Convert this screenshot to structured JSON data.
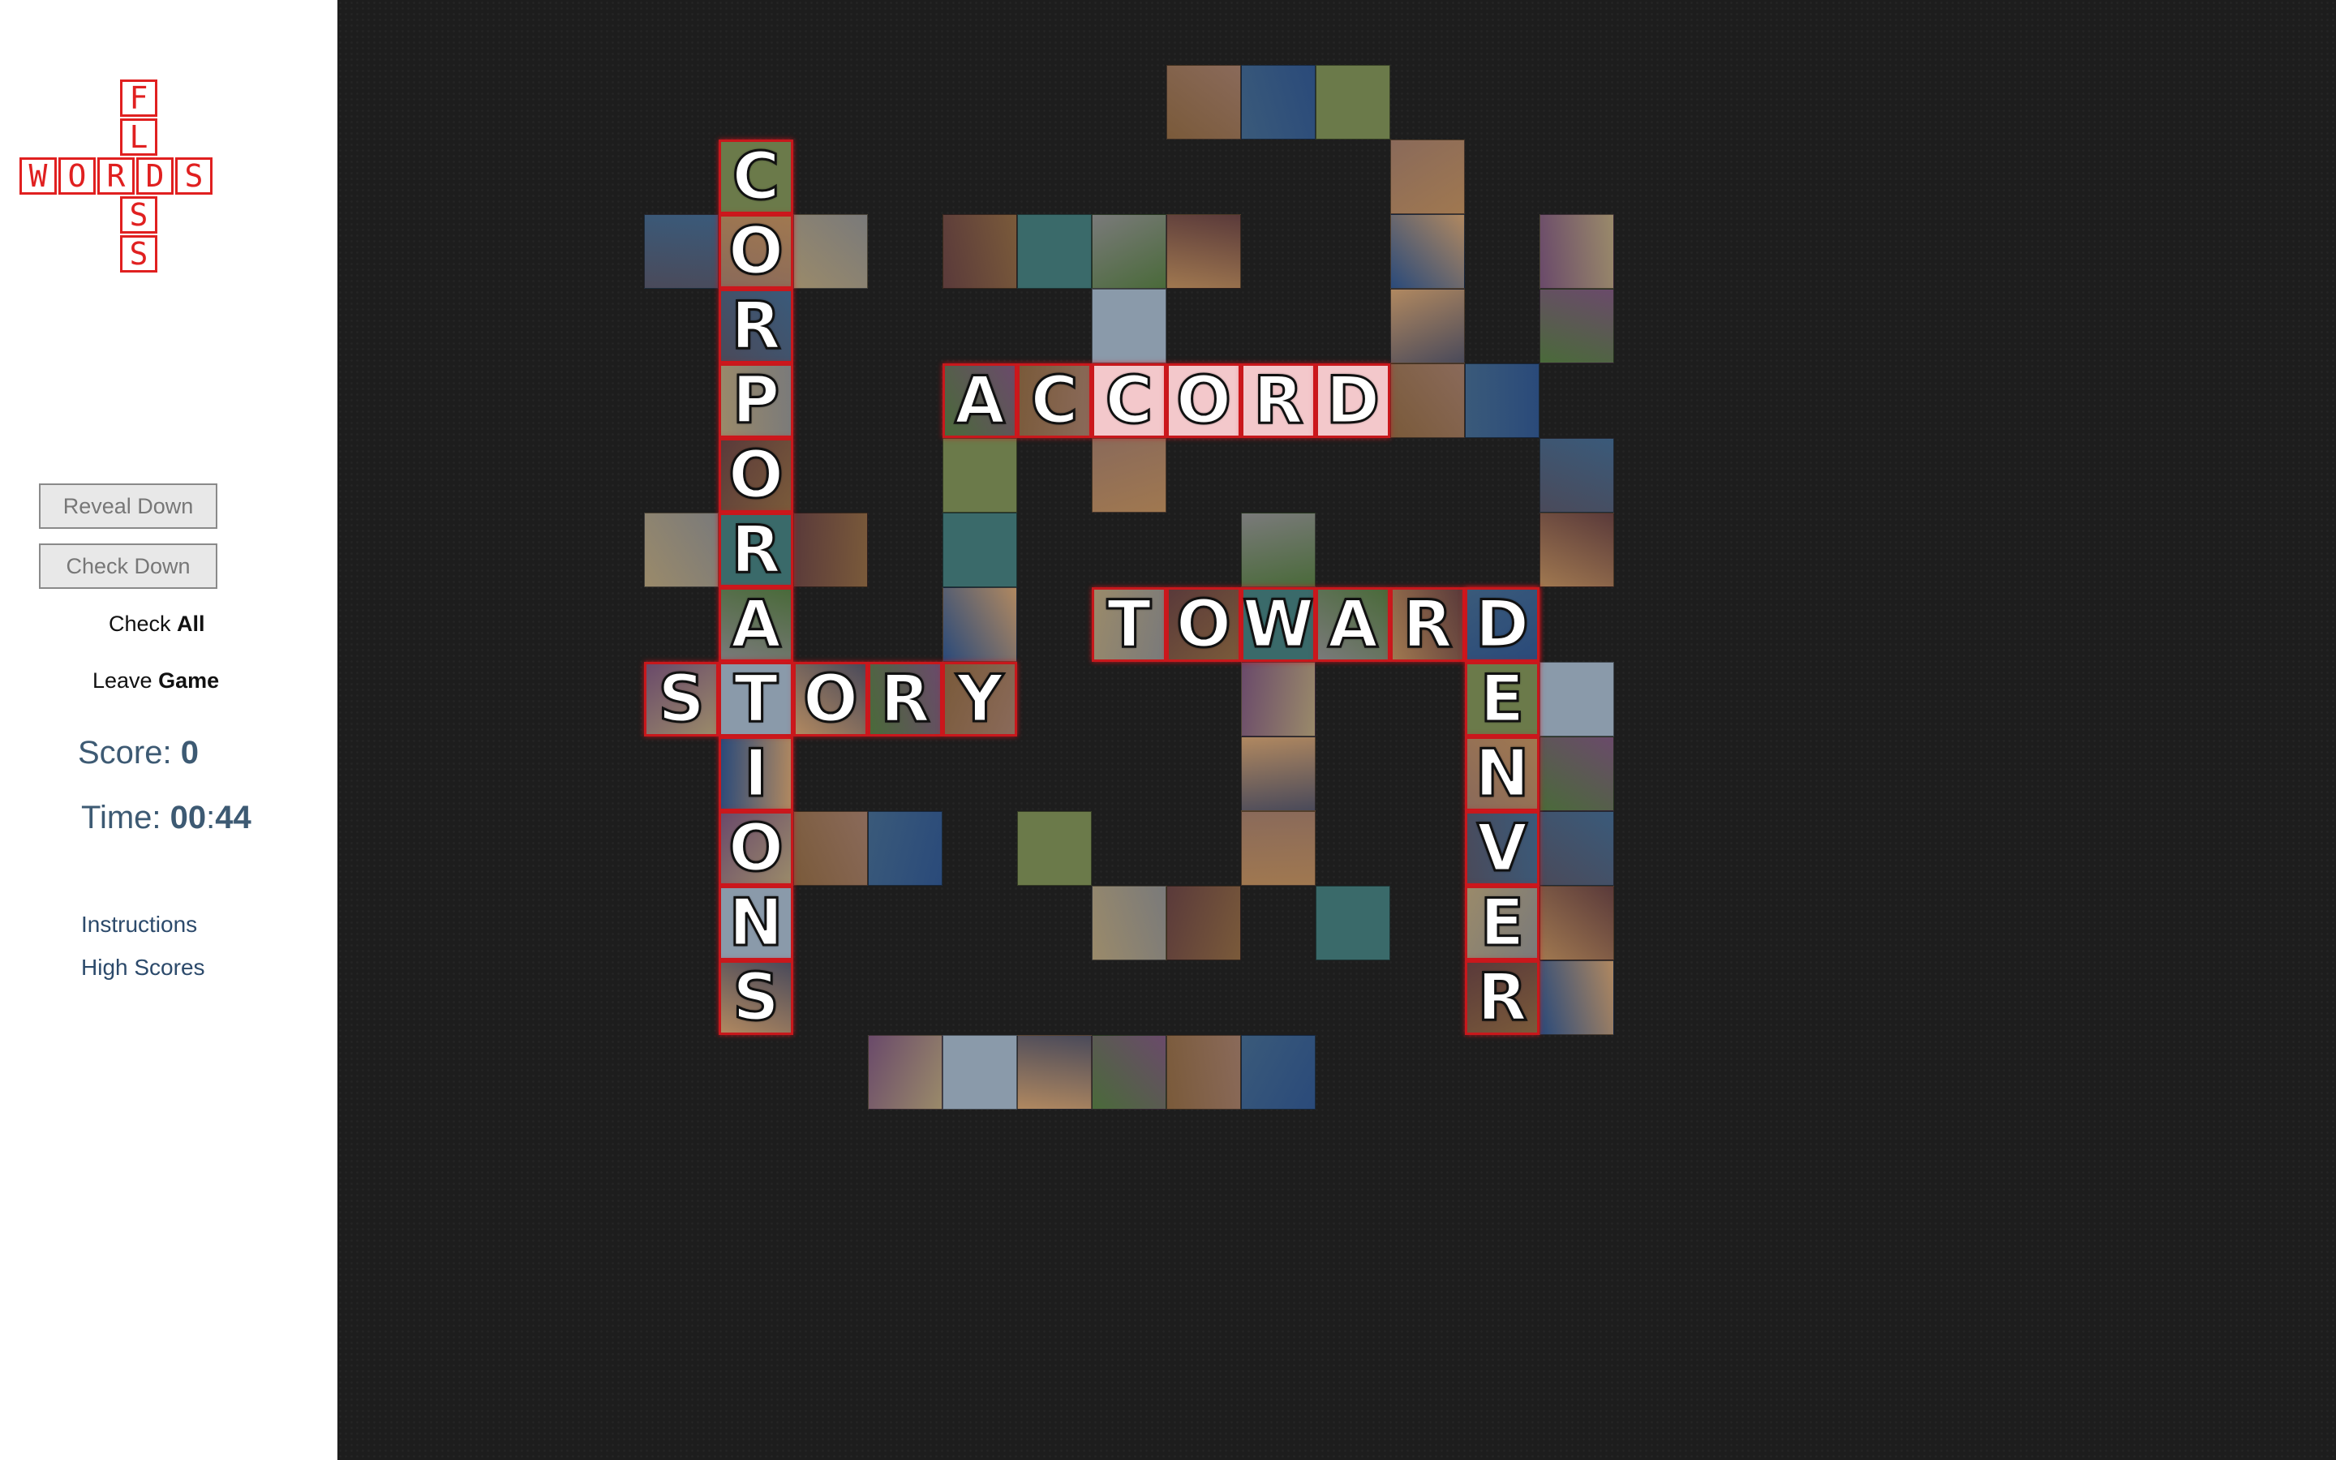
{
  "logo": {
    "horizontal": "WORDS",
    "vertical": "FLOSS",
    "color": "#e02020"
  },
  "controls": {
    "reveal_down": "Reveal Down",
    "check_down": "Check Down",
    "check_all_prefix": "Check",
    "check_all_bold": "All",
    "leave_game_prefix": "Leave",
    "leave_game_bold": "Game"
  },
  "score": {
    "label": "Score:",
    "value": "0"
  },
  "time": {
    "label": "Time:",
    "minutes": "00",
    "sep": ":",
    "seconds": "44"
  },
  "links": {
    "instructions": "Instructions",
    "high_scores": "High Scores"
  },
  "colors": {
    "board_bg": "#1d1d1d",
    "highlight": "#c8181c",
    "stat_text": "#3d5a73"
  },
  "answers": {
    "down_1": "CORPORATIONS",
    "across_1": "ACCORD",
    "across_2": "TOWARD",
    "across_3": "STORY",
    "down_2": "DENVER"
  }
}
